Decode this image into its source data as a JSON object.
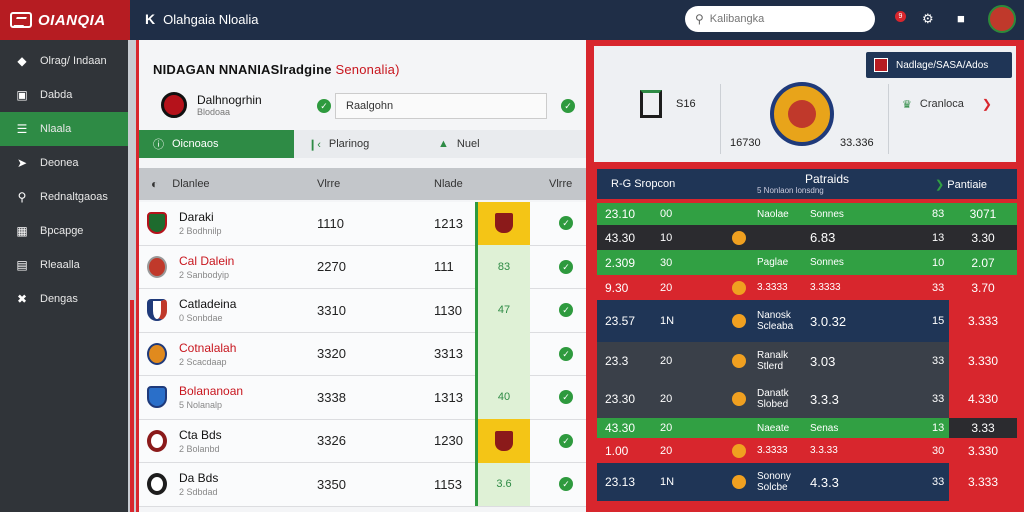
{
  "app": {
    "logo": "OIANQIA",
    "title_mark": "K",
    "title": "Olahgaia Nloalia"
  },
  "search": {
    "placeholder": "Kalibangka"
  },
  "header": {
    "notif_count": "9"
  },
  "sidebar": {
    "items": [
      {
        "label": "Olrag/ Indaan",
        "icon": "shield-icon"
      },
      {
        "label": "Dabda",
        "icon": "document-icon"
      },
      {
        "label": "Nlaala",
        "icon": "list-icon",
        "active": true
      },
      {
        "label": "Deonea",
        "icon": "share-icon"
      },
      {
        "label": "Rednaltgaoas",
        "icon": "search-icon"
      },
      {
        "label": "Bpcapge",
        "icon": "book-icon"
      },
      {
        "label": "Rleaalla",
        "icon": "grid-icon"
      },
      {
        "label": "Dengas",
        "icon": "close-icon"
      }
    ]
  },
  "left": {
    "title_main": "NIDAGAN NNANIASlradgine",
    "title_red": "Senonalia)",
    "team": {
      "name": "Dalhnogrhin",
      "sub": "Blodoaa"
    },
    "field_value": "Raalgohn",
    "tabs": [
      "Oicnoaos",
      "Plarinog",
      "Nuel"
    ],
    "columns": [
      "Dlanlee",
      "Vlrre",
      "Nlade",
      "Vlrre"
    ],
    "rows": [
      {
        "name": "Daraki",
        "sub": "2 Bodhnilp",
        "v1": "1110",
        "v2": "1213",
        "cell": "",
        "red": false,
        "gold": true
      },
      {
        "name": "Cal Dalein",
        "sub": "2 Sanbodyip",
        "v1": "2270",
        "v2": "111",
        "cell": "83",
        "red": true,
        "gold": false
      },
      {
        "name": "Catladeina",
        "sub": "0 Sonbdae",
        "v1": "3310",
        "v2": "1130",
        "cell": "47",
        "red": false,
        "gold": false
      },
      {
        "name": "Cotnalalah",
        "sub": "2 Scacdaap",
        "v1": "3320",
        "v2": "3313",
        "cell": "",
        "red": true,
        "gold": false
      },
      {
        "name": "Bolananoan",
        "sub": "5 Nolanalp",
        "v1": "3338",
        "v2": "1313",
        "cell": "40",
        "red": true,
        "gold": false
      },
      {
        "name": "Cta Bds",
        "sub": "2 Bolanbd",
        "v1": "3326",
        "v2": "1230",
        "cell": "",
        "red": false,
        "gold": true
      },
      {
        "name": "Da Bds",
        "sub": "2 Sdbdad",
        "v1": "3350",
        "v2": "1153",
        "cell": "3.6",
        "red": false,
        "gold": false
      }
    ]
  },
  "right": {
    "action": "Nadlage/SASA/Ados",
    "score_label": "S16",
    "score_left": "16730",
    "score_right": "33.336",
    "side_label": "Cranloca",
    "table_left": "R-G Sropcon",
    "table_center": "Patraids",
    "table_center_sub": "5 Nonlaon lonsdng",
    "table_right": "Pantiaie",
    "rows": [
      {
        "s": "23.10",
        "s2": "00",
        "lab": "Naolae",
        "lab2": "Sonnes",
        "mid": "",
        "n": "83",
        "r": "3071",
        "bg": "g",
        "rbg": "g",
        "icon": false
      },
      {
        "s": "43.30",
        "s2": "10",
        "lab": "",
        "lab2": "",
        "mid": "6.83",
        "n": "13",
        "r": "3.30",
        "bg": "d",
        "rbg": "d",
        "icon": true
      },
      {
        "s": "2.309",
        "s2": "30",
        "lab": "Paglae",
        "lab2": "Sonnes",
        "mid": "",
        "n": "10",
        "r": "2.07",
        "bg": "g",
        "rbg": "g",
        "icon": false
      },
      {
        "s": "9.30",
        "s2": "20",
        "lab": "3.3333",
        "lab2": "3.3333",
        "mid": "",
        "n": "33",
        "r": "3.70",
        "bg": "rd",
        "rbg": "rd",
        "icon": true
      },
      {
        "s": "23.57",
        "s2": "1N",
        "lab": "Nanosk",
        "lab2": "Scleaba",
        "mid": "3.0.32",
        "n": "15",
        "r": "3.333",
        "bg": "nv",
        "rbg": "rd",
        "icon": true
      },
      {
        "s": "23.3",
        "s2": "20",
        "lab": "Ranalk",
        "lab2": "Stlerd",
        "mid": "3.03",
        "n": "33",
        "r": "3.330",
        "bg": "gr",
        "rbg": "rd",
        "icon": true
      },
      {
        "s": "23.30",
        "s2": "20",
        "lab": "Danatk",
        "lab2": "Slobed",
        "mid": "3.3.3",
        "n": "33",
        "r": "4.330",
        "bg": "gr",
        "rbg": "rd",
        "icon": true
      },
      {
        "s": "43.30",
        "s2": "20",
        "lab": "Naeate",
        "lab2": "Senas",
        "mid": "",
        "n": "13",
        "r": "3.33",
        "bg": "g",
        "rbg": "d",
        "icon": false
      },
      {
        "s": "1.00",
        "s2": "20",
        "lab": "3.3333",
        "lab2": "3.3.33",
        "mid": "",
        "n": "30",
        "r": "3.330",
        "bg": "rd",
        "rbg": "rd",
        "icon": true
      },
      {
        "s": "23.13",
        "s2": "1N",
        "lab": "Sonony",
        "lab2": "Solcbe",
        "mid": "4.3.3",
        "n": "33",
        "r": "3.333",
        "bg": "nv",
        "rbg": "rd",
        "icon": true
      }
    ]
  }
}
